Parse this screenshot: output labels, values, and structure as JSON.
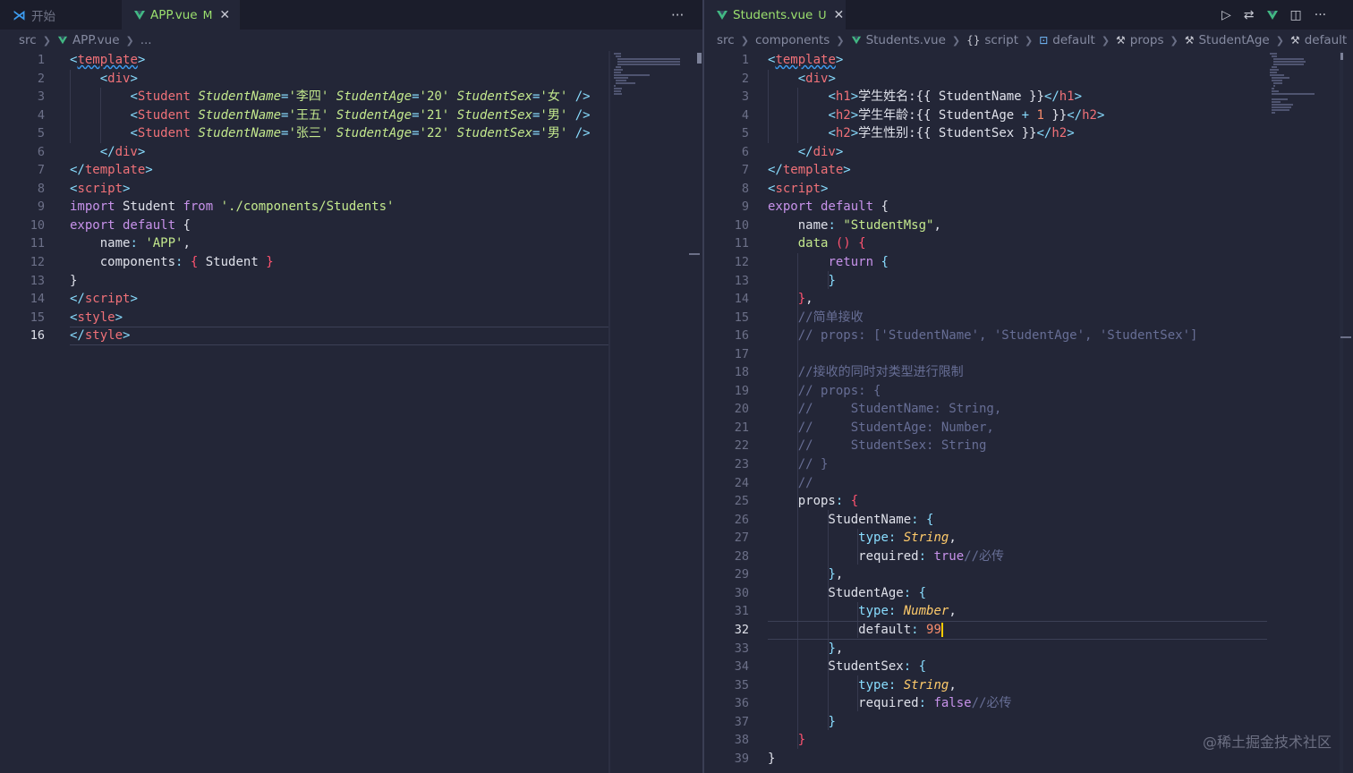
{
  "left_pane": {
    "tabs": [
      {
        "label": "开始",
        "icon": "vscode-icon",
        "active": false
      },
      {
        "label": "APP.vue",
        "status": "M",
        "icon": "vue-icon",
        "active": true
      }
    ],
    "more_actions": "···",
    "breadcrumb": [
      "src",
      "APP.vue",
      "..."
    ],
    "current_line": 16,
    "lines": [
      [
        [
          "t-punc",
          "<"
        ],
        [
          "t-tag squig",
          "template"
        ],
        [
          "t-punc",
          ">"
        ]
      ],
      [
        [
          "",
          "    "
        ],
        [
          "t-punc",
          "<"
        ],
        [
          "t-tag",
          "div"
        ],
        [
          "t-punc",
          ">"
        ]
      ],
      [
        [
          "",
          "        "
        ],
        [
          "t-punc",
          "<"
        ],
        [
          "t-tag",
          "Student"
        ],
        [
          "",
          "",
          " "
        ],
        [
          "t-attr",
          "StudentName"
        ],
        [
          "t-punc",
          "="
        ],
        [
          "t-str",
          "'李四'"
        ],
        [
          "",
          " "
        ],
        [
          "t-attr",
          "StudentAge"
        ],
        [
          "t-punc",
          "="
        ],
        [
          "t-str",
          "'20'"
        ],
        [
          "",
          " "
        ],
        [
          "t-attr",
          "StudentSex"
        ],
        [
          "t-punc",
          "="
        ],
        [
          "t-str",
          "'女'"
        ],
        [
          "",
          " "
        ],
        [
          "t-punc",
          "/>"
        ]
      ],
      [
        [
          "",
          "        "
        ],
        [
          "t-punc",
          "<"
        ],
        [
          "t-tag",
          "Student"
        ],
        [
          "",
          " "
        ],
        [
          "t-attr",
          "StudentName"
        ],
        [
          "t-punc",
          "="
        ],
        [
          "t-str",
          "'王五'"
        ],
        [
          "",
          " "
        ],
        [
          "t-attr",
          "StudentAge"
        ],
        [
          "t-punc",
          "="
        ],
        [
          "t-str",
          "'21'"
        ],
        [
          "",
          " "
        ],
        [
          "t-attr",
          "StudentSex"
        ],
        [
          "t-punc",
          "="
        ],
        [
          "t-str",
          "'男'"
        ],
        [
          "",
          " "
        ],
        [
          "t-punc",
          "/>"
        ]
      ],
      [
        [
          "",
          "        "
        ],
        [
          "t-punc",
          "<"
        ],
        [
          "t-tag",
          "Student"
        ],
        [
          "",
          " "
        ],
        [
          "t-attr",
          "StudentName"
        ],
        [
          "t-punc",
          "="
        ],
        [
          "t-str",
          "'张三'"
        ],
        [
          "",
          " "
        ],
        [
          "t-attr",
          "StudentAge"
        ],
        [
          "t-punc",
          "="
        ],
        [
          "t-str",
          "'22'"
        ],
        [
          "",
          " "
        ],
        [
          "t-attr",
          "StudentSex"
        ],
        [
          "t-punc",
          "="
        ],
        [
          "t-str",
          "'男'"
        ],
        [
          "",
          " "
        ],
        [
          "t-punc",
          "/>"
        ]
      ],
      [
        [
          "",
          "    "
        ],
        [
          "t-punc",
          "</"
        ],
        [
          "t-tag",
          "div"
        ],
        [
          "t-punc",
          ">"
        ]
      ],
      [
        [
          "t-punc",
          "</"
        ],
        [
          "t-tag",
          "template"
        ],
        [
          "t-punc",
          ">"
        ]
      ],
      [
        [
          "t-punc",
          "<"
        ],
        [
          "t-tag",
          "script"
        ],
        [
          "t-punc",
          ">"
        ]
      ],
      [
        [
          "t-kw",
          "import"
        ],
        [
          "",
          " Student "
        ],
        [
          "t-kw",
          "from"
        ],
        [
          "",
          " "
        ],
        [
          "t-str",
          "'./components/Students'"
        ]
      ],
      [
        [
          "t-kw",
          "export default"
        ],
        [
          "",
          " {"
        ]
      ],
      [
        [
          "",
          "    name"
        ],
        [
          "t-punc",
          ":"
        ],
        [
          "",
          " "
        ],
        [
          "t-str",
          "'APP'"
        ],
        [
          "",
          ","
        ]
      ],
      [
        [
          "",
          "    components"
        ],
        [
          "t-punc",
          ":"
        ],
        [
          "",
          " "
        ],
        [
          "t-brk",
          "{"
        ],
        [
          "",
          " Student "
        ],
        [
          "t-brk",
          "}"
        ]
      ],
      [
        [
          "",
          "}"
        ]
      ],
      [
        [
          "t-punc",
          "</"
        ],
        [
          "t-tag",
          "script"
        ],
        [
          "t-punc",
          ">"
        ]
      ],
      [
        [
          "t-punc",
          "<"
        ],
        [
          "t-tag",
          "style"
        ],
        [
          "t-punc",
          ">"
        ]
      ],
      [
        [
          "t-punc",
          "</"
        ],
        [
          "t-tag",
          "style"
        ],
        [
          "t-punc",
          ">"
        ]
      ]
    ]
  },
  "right_pane": {
    "tabs": [
      {
        "label": "Students.vue",
        "status": "U",
        "icon": "vue-icon",
        "active": true
      }
    ],
    "action_icons": [
      "run-icon",
      "compare-icon",
      "vue-devtools-icon",
      "split-editor-icon",
      "more-icon"
    ],
    "breadcrumb": [
      {
        "label": "src",
        "glyph": ""
      },
      {
        "label": "components",
        "glyph": ""
      },
      {
        "label": "Students.vue",
        "glyph": "vue"
      },
      {
        "label": "script",
        "glyph": "{}"
      },
      {
        "label": "default",
        "glyph": "⊡"
      },
      {
        "label": "props",
        "glyph": "🔧"
      },
      {
        "label": "StudentAge",
        "glyph": "🔧"
      },
      {
        "label": "default",
        "glyph": "🔧"
      }
    ],
    "current_line": 32,
    "lines": [
      [
        [
          "t-punc",
          "<"
        ],
        [
          "t-tag squig",
          "template"
        ],
        [
          "t-punc",
          ">"
        ]
      ],
      [
        [
          "",
          "    "
        ],
        [
          "t-punc",
          "<"
        ],
        [
          "t-tag",
          "div"
        ],
        [
          "t-punc",
          ">"
        ]
      ],
      [
        [
          "",
          "        "
        ],
        [
          "t-punc",
          "<"
        ],
        [
          "t-tag",
          "h1"
        ],
        [
          "t-punc",
          ">"
        ],
        [
          "",
          "学生姓名:{{ StudentName }}"
        ],
        [
          "t-punc",
          "</"
        ],
        [
          "t-tag",
          "h1"
        ],
        [
          "t-punc",
          ">"
        ]
      ],
      [
        [
          "",
          "        "
        ],
        [
          "t-punc",
          "<"
        ],
        [
          "t-tag",
          "h2"
        ],
        [
          "t-punc",
          ">"
        ],
        [
          "",
          "学生年龄:{{ StudentAge "
        ],
        [
          "t-punc",
          "+"
        ],
        [
          "",
          " "
        ],
        [
          "t-num",
          "1"
        ],
        [
          "",
          " }}"
        ],
        [
          "t-punc",
          "</"
        ],
        [
          "t-tag",
          "h2"
        ],
        [
          "t-punc",
          ">"
        ]
      ],
      [
        [
          "",
          "        "
        ],
        [
          "t-punc",
          "<"
        ],
        [
          "t-tag",
          "h2"
        ],
        [
          "t-punc",
          ">"
        ],
        [
          "",
          "学生性别:{{ StudentSex }}"
        ],
        [
          "t-punc",
          "</"
        ],
        [
          "t-tag",
          "h2"
        ],
        [
          "t-punc",
          ">"
        ]
      ],
      [
        [
          "",
          "    "
        ],
        [
          "t-punc",
          "</"
        ],
        [
          "t-tag",
          "div"
        ],
        [
          "t-punc",
          ">"
        ]
      ],
      [
        [
          "t-punc",
          "</"
        ],
        [
          "t-tag",
          "template"
        ],
        [
          "t-punc",
          ">"
        ]
      ],
      [
        [
          "t-punc",
          "<"
        ],
        [
          "t-tag",
          "script"
        ],
        [
          "t-punc",
          ">"
        ]
      ],
      [
        [
          "t-kw",
          "export default"
        ],
        [
          "",
          " {"
        ]
      ],
      [
        [
          "",
          "    name"
        ],
        [
          "t-punc",
          ":"
        ],
        [
          "",
          " "
        ],
        [
          "t-str",
          "\"StudentMsg\""
        ],
        [
          "",
          ","
        ]
      ],
      [
        [
          "",
          "    "
        ],
        [
          "t-str",
          "data"
        ],
        [
          "",
          " "
        ],
        [
          "t-brk",
          "()"
        ],
        [
          "",
          " "
        ],
        [
          "t-brk",
          "{"
        ]
      ],
      [
        [
          "",
          "        "
        ],
        [
          "t-kw",
          "return"
        ],
        [
          "",
          " "
        ],
        [
          "t-punc",
          "{"
        ]
      ],
      [
        [
          "",
          "        "
        ],
        [
          "t-punc",
          "}"
        ]
      ],
      [
        [
          "",
          "    "
        ],
        [
          "t-brk",
          "}"
        ],
        [
          "",
          ","
        ]
      ],
      [
        [
          "",
          "    "
        ],
        [
          "t-com",
          "//简单接收"
        ]
      ],
      [
        [
          "",
          "    "
        ],
        [
          "t-com",
          "// props: ['StudentName', 'StudentAge', 'StudentSex']"
        ]
      ],
      [
        [
          "",
          ""
        ]
      ],
      [
        [
          "",
          "    "
        ],
        [
          "t-com",
          "//接收的同时对类型进行限制"
        ]
      ],
      [
        [
          "",
          "    "
        ],
        [
          "t-com",
          "// props: {"
        ]
      ],
      [
        [
          "",
          "    "
        ],
        [
          "t-com",
          "//     StudentName: String,"
        ]
      ],
      [
        [
          "",
          "    "
        ],
        [
          "t-com",
          "//     StudentAge: Number,"
        ]
      ],
      [
        [
          "",
          "    "
        ],
        [
          "t-com",
          "//     StudentSex: String"
        ]
      ],
      [
        [
          "",
          "    "
        ],
        [
          "t-com",
          "// }"
        ]
      ],
      [
        [
          "",
          "    "
        ],
        [
          "t-com",
          "//"
        ]
      ],
      [
        [
          "",
          "    props"
        ],
        [
          "t-punc",
          ":"
        ],
        [
          "",
          " "
        ],
        [
          "t-brk",
          "{"
        ]
      ],
      [
        [
          "",
          "        StudentName"
        ],
        [
          "t-punc",
          ":"
        ],
        [
          "",
          " "
        ],
        [
          "t-punc",
          "{"
        ]
      ],
      [
        [
          "",
          "            "
        ],
        [
          "t-punc",
          "type"
        ],
        [
          "t-punc",
          ":"
        ],
        [
          "",
          " "
        ],
        [
          "t-type",
          "String"
        ],
        [
          "",
          ","
        ]
      ],
      [
        [
          "",
          "            required"
        ],
        [
          "t-punc",
          ":"
        ],
        [
          "",
          " "
        ],
        [
          "t-bool",
          "true"
        ],
        [
          "t-com",
          "//必传"
        ]
      ],
      [
        [
          "",
          "        "
        ],
        [
          "t-punc",
          "}"
        ],
        [
          "",
          ","
        ]
      ],
      [
        [
          "",
          "        StudentAge"
        ],
        [
          "t-punc",
          ":"
        ],
        [
          "",
          " "
        ],
        [
          "t-punc",
          "{"
        ]
      ],
      [
        [
          "",
          "            "
        ],
        [
          "t-punc",
          "type"
        ],
        [
          "t-punc",
          ":"
        ],
        [
          "",
          " "
        ],
        [
          "t-type",
          "Number"
        ],
        [
          "",
          ","
        ]
      ],
      [
        [
          "",
          "            default"
        ],
        [
          "t-punc",
          ":"
        ],
        [
          "",
          " "
        ],
        [
          "t-num",
          "99"
        ]
      ],
      [
        [
          "",
          "        "
        ],
        [
          "t-punc",
          "}"
        ],
        [
          "",
          ","
        ]
      ],
      [
        [
          "",
          "        StudentSex"
        ],
        [
          "t-punc",
          ":"
        ],
        [
          "",
          " "
        ],
        [
          "t-punc",
          "{"
        ]
      ],
      [
        [
          "",
          "            "
        ],
        [
          "t-punc",
          "type"
        ],
        [
          "t-punc",
          ":"
        ],
        [
          "",
          " "
        ],
        [
          "t-type",
          "String"
        ],
        [
          "",
          ","
        ]
      ],
      [
        [
          "",
          "            required"
        ],
        [
          "t-punc",
          ":"
        ],
        [
          "",
          " "
        ],
        [
          "t-bool",
          "false"
        ],
        [
          "t-com",
          "//必传"
        ]
      ],
      [
        [
          "",
          "        "
        ],
        [
          "t-punc",
          "}"
        ]
      ],
      [
        [
          "",
          "    "
        ],
        [
          "t-brk",
          "}"
        ]
      ],
      [
        [
          "",
          "}"
        ]
      ]
    ]
  },
  "watermark": "@稀土掘金技术社区",
  "colors": {
    "background": "#232637",
    "tabbar": "#1b1d2b",
    "vue_green": "#42b883",
    "active_tab_text": "#9be06e",
    "cursor": "#ffcc00"
  }
}
